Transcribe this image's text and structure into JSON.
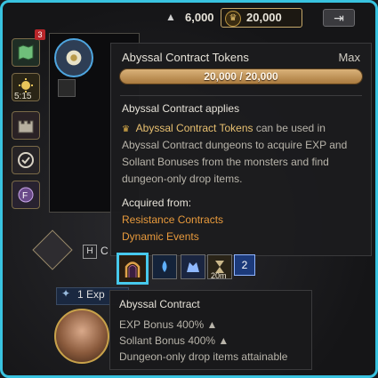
{
  "topbar": {
    "silver_value": "6,000",
    "token_value": "20,000",
    "arrow_glyph": "⇥"
  },
  "sidebar": {
    "badge": "3",
    "timer": "5:15"
  },
  "tooltip_tokens": {
    "title": "Abyssal Contract Tokens",
    "max_label": "Max",
    "progress_text": "20,000 / 20,000",
    "progress_fraction": 1.0,
    "applies": "Abyssal Contract applies",
    "desc_highlight": "Abyssal Contract Tokens",
    "desc_rest": " can be used in Abyssal Contract dungeons to acquire EXP and Sollant Bonuses from the monsters and find dungeon-only drop items.",
    "acquired_from": "Acquired from:",
    "sources": [
      "Resistance Contracts",
      "Dynamic Events"
    ]
  },
  "hotkey": {
    "key": "H",
    "label": "C"
  },
  "buffs": {
    "buff4_label": "20m",
    "buff5_label": "2"
  },
  "exp": {
    "label": "1 Exp"
  },
  "tooltip_contract": {
    "title": "Abyssal Contract",
    "line1": "EXP Bonus 400% ▲",
    "line2": "Sollant Bonus 400% ▲",
    "line3": "Dungeon-only drop items attainable"
  },
  "colors": {
    "accent_frame": "#39c3e0",
    "highlight_gold": "#e8c070",
    "source_orange": "#e89a3c"
  }
}
